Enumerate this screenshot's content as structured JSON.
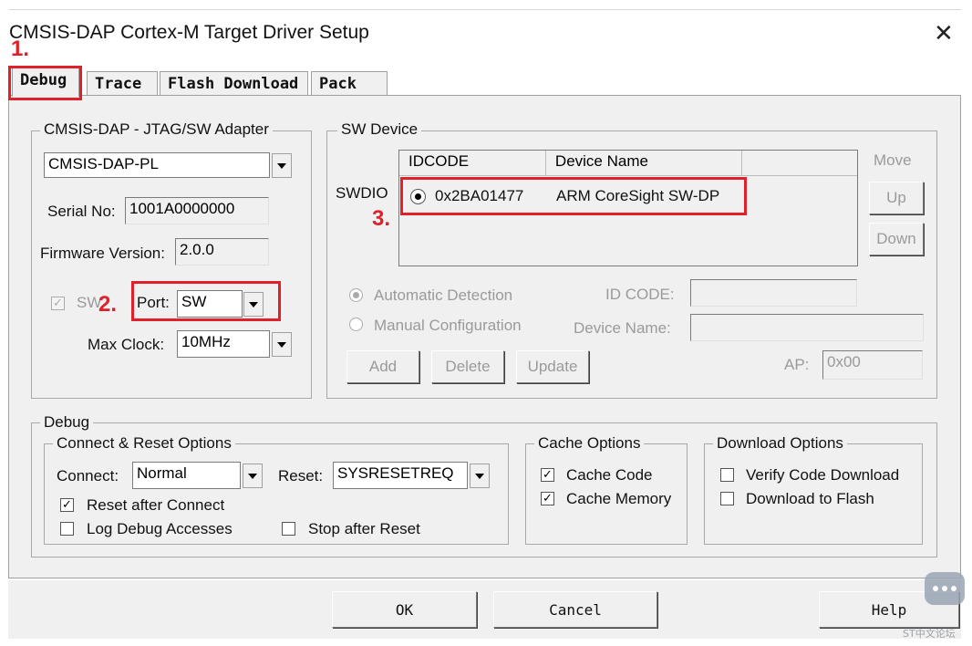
{
  "window": {
    "title": "CMSIS-DAP Cortex-M Target Driver Setup",
    "close_glyph": "✕"
  },
  "tabs": [
    {
      "label": "Debug",
      "active": true
    },
    {
      "label": "Trace",
      "active": false
    },
    {
      "label": "Flash Download",
      "active": false
    },
    {
      "label": "Pack",
      "active": false
    }
  ],
  "adapter": {
    "group_label": "CMSIS-DAP - JTAG/SW Adapter",
    "selected": "CMSIS-DAP-PL",
    "serial_label": "Serial No:",
    "serial_value": "1001A0000000",
    "firmware_label": "Firmware Version:",
    "firmware_value": "2.0.0",
    "swj_label": "SW",
    "swj_checked": true,
    "port_label": "Port:",
    "port_value": "SW",
    "maxclock_label": "Max Clock:",
    "maxclock_value": "10MHz"
  },
  "sw_device": {
    "group_label": "SW Device",
    "row_label": "SWDIO",
    "columns": [
      "IDCODE",
      "Device Name"
    ],
    "rows": [
      {
        "idcode": "0x2BA01477",
        "device_name": "ARM CoreSight SW-DP"
      }
    ],
    "move_label": "Move",
    "up_label": "Up",
    "down_label": "Down",
    "auto_detect_label": "Automatic Detection",
    "manual_config_label": "Manual Configuration",
    "idcode_label": "ID CODE:",
    "devname_label": "Device Name:",
    "ap_label": "AP:",
    "ap_value": "0x00",
    "add_label": "Add",
    "delete_label": "Delete",
    "update_label": "Update"
  },
  "debug": {
    "group_label": "Debug",
    "connect_reset": {
      "group_label": "Connect & Reset Options",
      "connect_label": "Connect:",
      "connect_value": "Normal",
      "reset_label": "Reset:",
      "reset_value": "SYSRESETREQ",
      "reset_after_connect": {
        "label": "Reset after Connect",
        "checked": true
      },
      "log_debug": {
        "label": "Log Debug Accesses",
        "checked": false
      },
      "stop_after_reset": {
        "label": "Stop after Reset",
        "checked": false
      }
    },
    "cache": {
      "group_label": "Cache Options",
      "cache_code": {
        "label": "Cache Code",
        "checked": true
      },
      "cache_memory": {
        "label": "Cache Memory",
        "checked": true
      }
    },
    "download": {
      "group_label": "Download Options",
      "verify": {
        "label": "Verify Code Download",
        "checked": false
      },
      "to_flash": {
        "label": "Download to Flash",
        "checked": false
      }
    }
  },
  "buttons": {
    "ok": "OK",
    "cancel": "Cancel",
    "help": "Help"
  },
  "annotations": {
    "n1": "1.",
    "n2": "2.",
    "n3": "3."
  },
  "watermark": "ST中文论坛",
  "colors": {
    "annotation_red": "#e0202a",
    "dialog_bg": "#f0f0f0"
  }
}
